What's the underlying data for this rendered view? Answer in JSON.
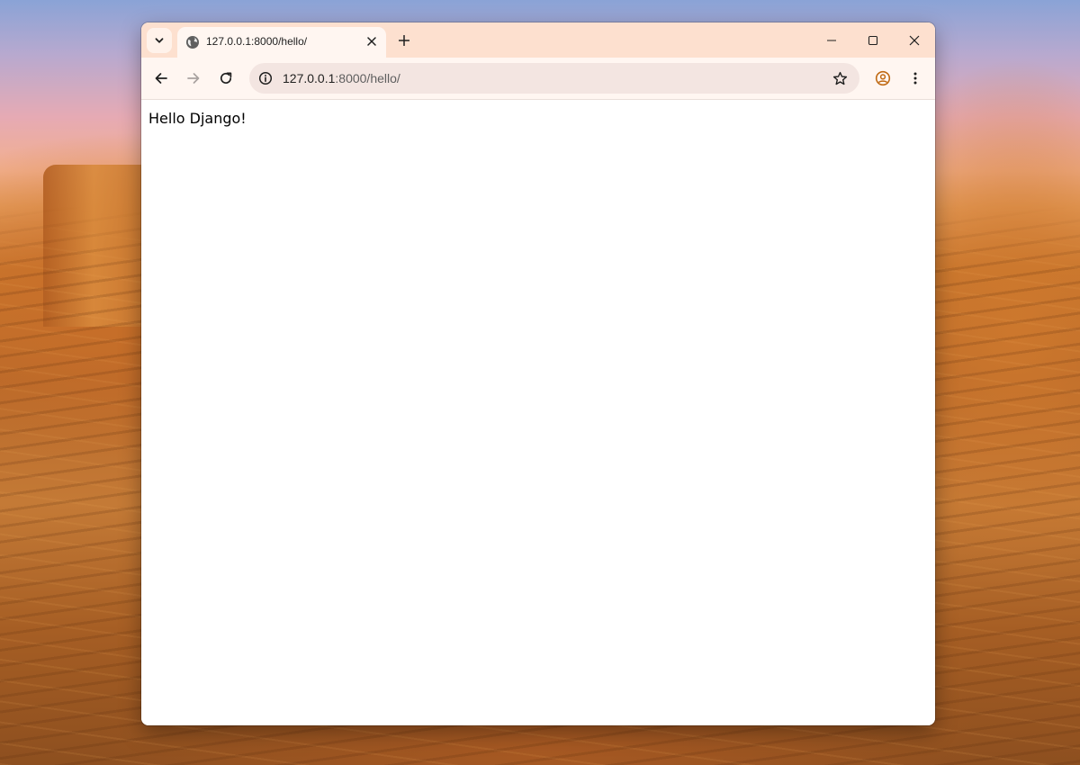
{
  "browser": {
    "tab": {
      "title": "127.0.0.1:8000/hello/",
      "favicon_icon": "globe-icon"
    },
    "address_bar": {
      "url_host": "127.0.0.1",
      "url_rest": ":8000/hello/"
    },
    "toolbar_icons": [
      "back-arrow-icon",
      "forward-arrow-icon",
      "reload-icon",
      "site-info-icon",
      "star-icon",
      "profile-icon",
      "kebab-menu-icon"
    ],
    "window_controls": [
      "minimize-icon",
      "maximize-icon",
      "close-icon"
    ]
  },
  "page": {
    "body_text": "Hello Django!"
  },
  "colors": {
    "tabstrip": "#fde0cf",
    "toolbar": "#fff6f1",
    "omnibox": "#f3e5e1",
    "profile_accent": "#c06a14"
  }
}
